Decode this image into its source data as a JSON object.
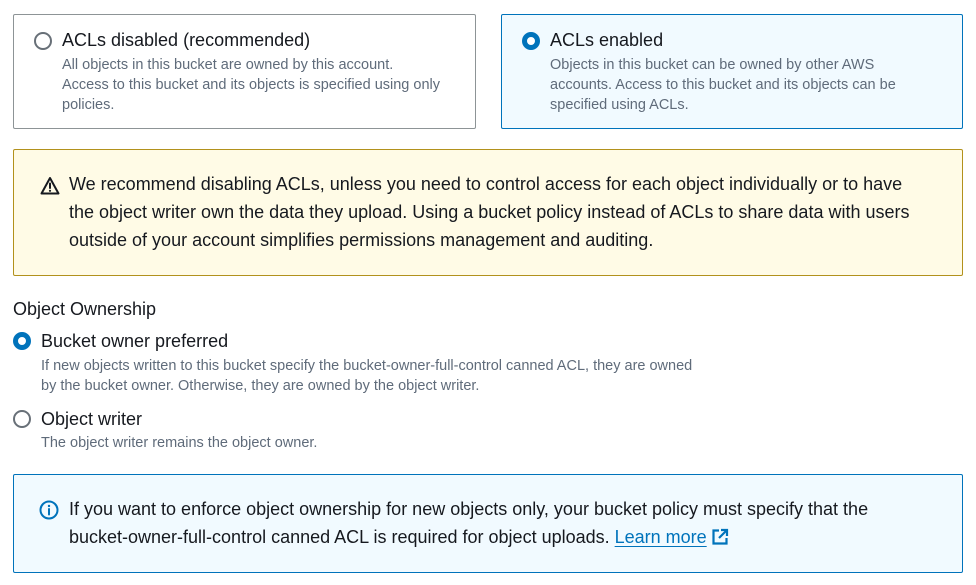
{
  "acl_tiles": [
    {
      "title": "ACLs disabled (recommended)",
      "description": "All objects in this bucket are owned by this account. Access to this bucket and its objects is specified using only policies.",
      "selected": false
    },
    {
      "title": "ACLs enabled",
      "description": "Objects in this bucket can be owned by other AWS accounts. Access to this bucket and its objects can be specified using ACLs.",
      "selected": true
    }
  ],
  "warning": {
    "icon": "warning-triangle-icon",
    "text": "We recommend disabling ACLs, unless you need to control access for each object individually or to have the object writer own the data they upload. Using a bucket policy instead of ACLs to share data with users outside of your account simplifies permissions management and auditing."
  },
  "object_ownership": {
    "label": "Object Ownership",
    "options": [
      {
        "title": "Bucket owner preferred",
        "description": "If new objects written to this bucket specify the bucket-owner-full-control canned ACL, they are owned by the bucket owner. Otherwise, they are owned by the object writer.",
        "selected": true
      },
      {
        "title": "Object writer",
        "description": "The object writer remains the object owner.",
        "selected": false
      }
    ]
  },
  "info": {
    "icon": "info-circle-icon",
    "text": "If you want to enforce object ownership for new objects only, your bucket policy must specify that the bucket-owner-full-control canned ACL is required for object uploads.",
    "link_label": "Learn more",
    "link_icon": "external-link-icon"
  },
  "colors": {
    "accent": "#0073bb",
    "warning_border": "#b2911c",
    "warning_bg": "#fffbe6",
    "info_bg": "#f1faff"
  }
}
